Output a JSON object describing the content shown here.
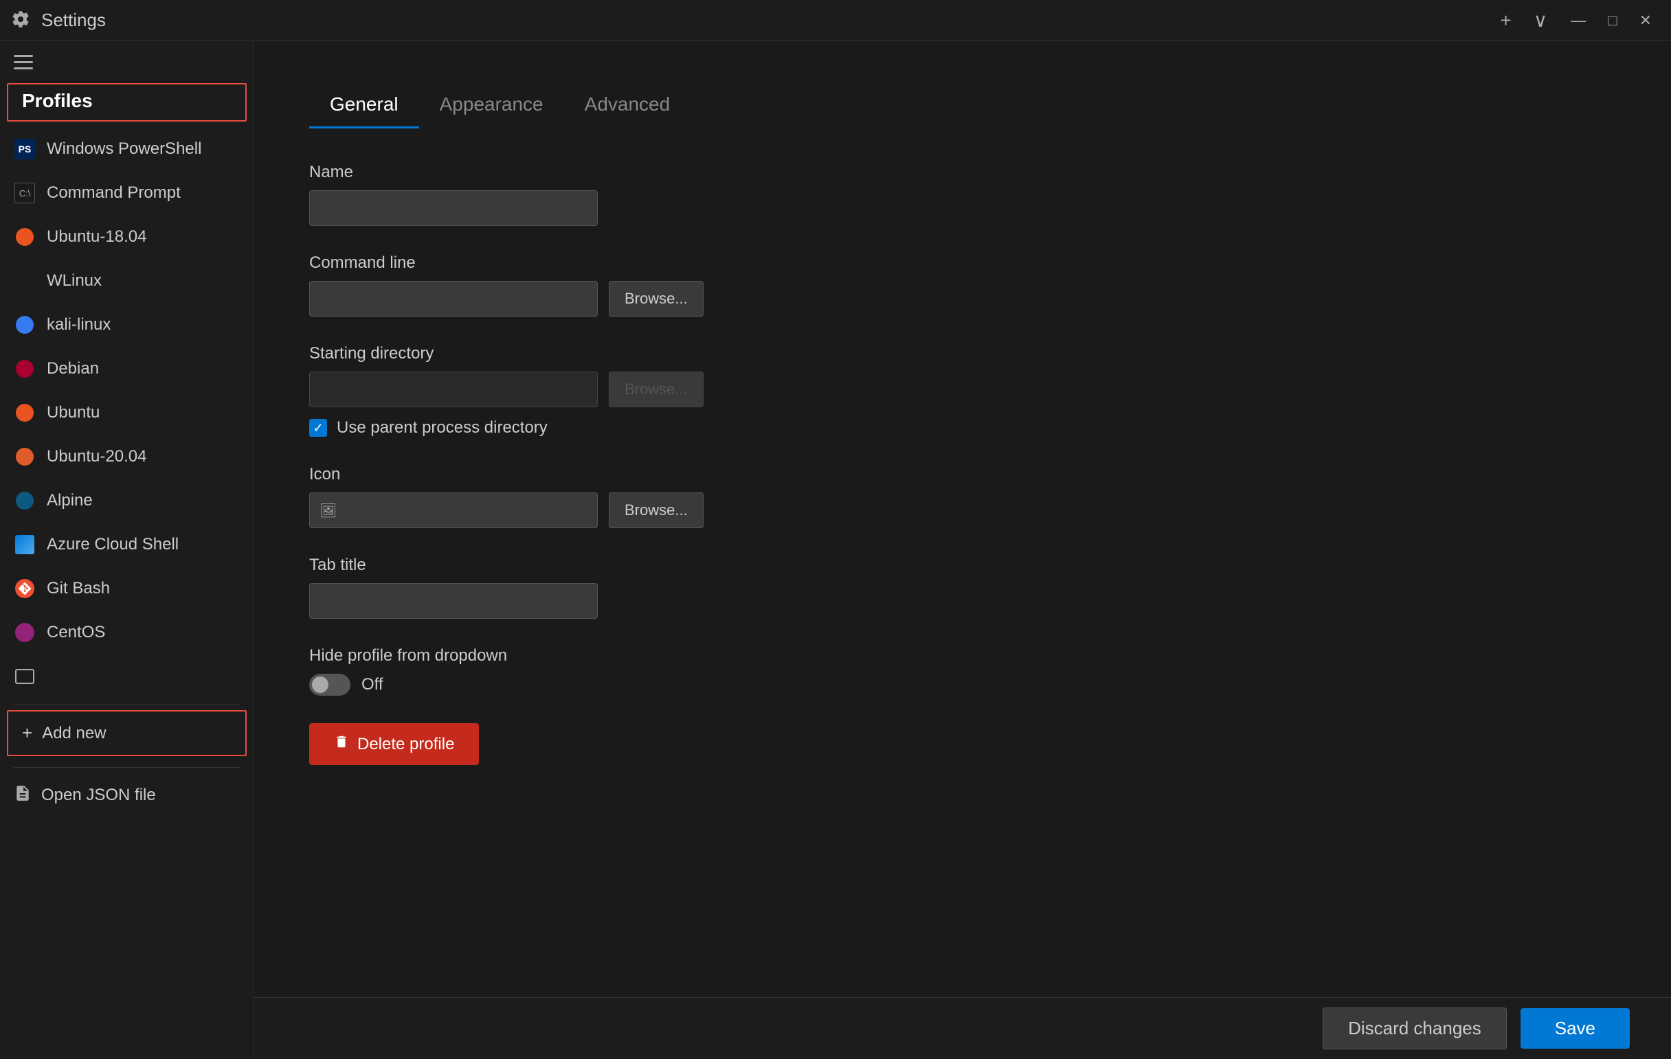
{
  "titleBar": {
    "title": "Settings",
    "icon": "⚙",
    "addTab": "+",
    "chevron": "∨",
    "minimize": "—",
    "maximize": "□",
    "close": "✕"
  },
  "sidebar": {
    "hamburger": "menu",
    "profilesHeading": "Profiles",
    "items": [
      {
        "id": "windows-powershell",
        "label": "Windows PowerShell",
        "iconType": "ps"
      },
      {
        "id": "command-prompt",
        "label": "Command Prompt",
        "iconType": "cmd"
      },
      {
        "id": "ubuntu-1804",
        "label": "Ubuntu-18.04",
        "iconType": "ubuntu-orange"
      },
      {
        "id": "wlinux",
        "label": "WLinux",
        "iconType": "none"
      },
      {
        "id": "kali-linux",
        "label": "kali-linux",
        "iconType": "kali"
      },
      {
        "id": "debian",
        "label": "Debian",
        "iconType": "debian"
      },
      {
        "id": "ubuntu",
        "label": "Ubuntu",
        "iconType": "ubuntu-orange"
      },
      {
        "id": "ubuntu-2004",
        "label": "Ubuntu-20.04",
        "iconType": "ubuntu-orange2"
      },
      {
        "id": "alpine",
        "label": "Alpine",
        "iconType": "alpine"
      },
      {
        "id": "azure-cloud-shell",
        "label": "Azure Cloud Shell",
        "iconType": "azure"
      },
      {
        "id": "git-bash",
        "label": "Git Bash",
        "iconType": "git"
      },
      {
        "id": "centos",
        "label": "CentOS",
        "iconType": "centos"
      },
      {
        "id": "screen",
        "label": "",
        "iconType": "screen"
      }
    ],
    "addNew": {
      "label": "Add new"
    },
    "openJson": {
      "label": "Open JSON file"
    }
  },
  "content": {
    "tabs": [
      {
        "id": "general",
        "label": "General",
        "active": true
      },
      {
        "id": "appearance",
        "label": "Appearance",
        "active": false
      },
      {
        "id": "advanced",
        "label": "Advanced",
        "active": false
      }
    ],
    "fields": {
      "name": {
        "label": "Name",
        "value": "",
        "placeholder": ""
      },
      "commandLine": {
        "label": "Command line",
        "value": "",
        "placeholder": "",
        "browseLabel": "Browse..."
      },
      "startingDirectory": {
        "label": "Starting directory",
        "value": "",
        "placeholder": "",
        "browseLabel": "Browse...",
        "checkboxLabel": "Use parent process directory",
        "checkboxChecked": true
      },
      "icon": {
        "label": "Icon",
        "value": "",
        "placeholder": "",
        "browseLabel": "Browse..."
      },
      "tabTitle": {
        "label": "Tab title",
        "value": "",
        "placeholder": ""
      },
      "hideProfile": {
        "label": "Hide profile from dropdown",
        "toggleState": false,
        "toggleLabel": "Off"
      }
    },
    "deleteButton": "Delete profile"
  },
  "bottomBar": {
    "discardLabel": "Discard changes",
    "saveLabel": "Save"
  }
}
